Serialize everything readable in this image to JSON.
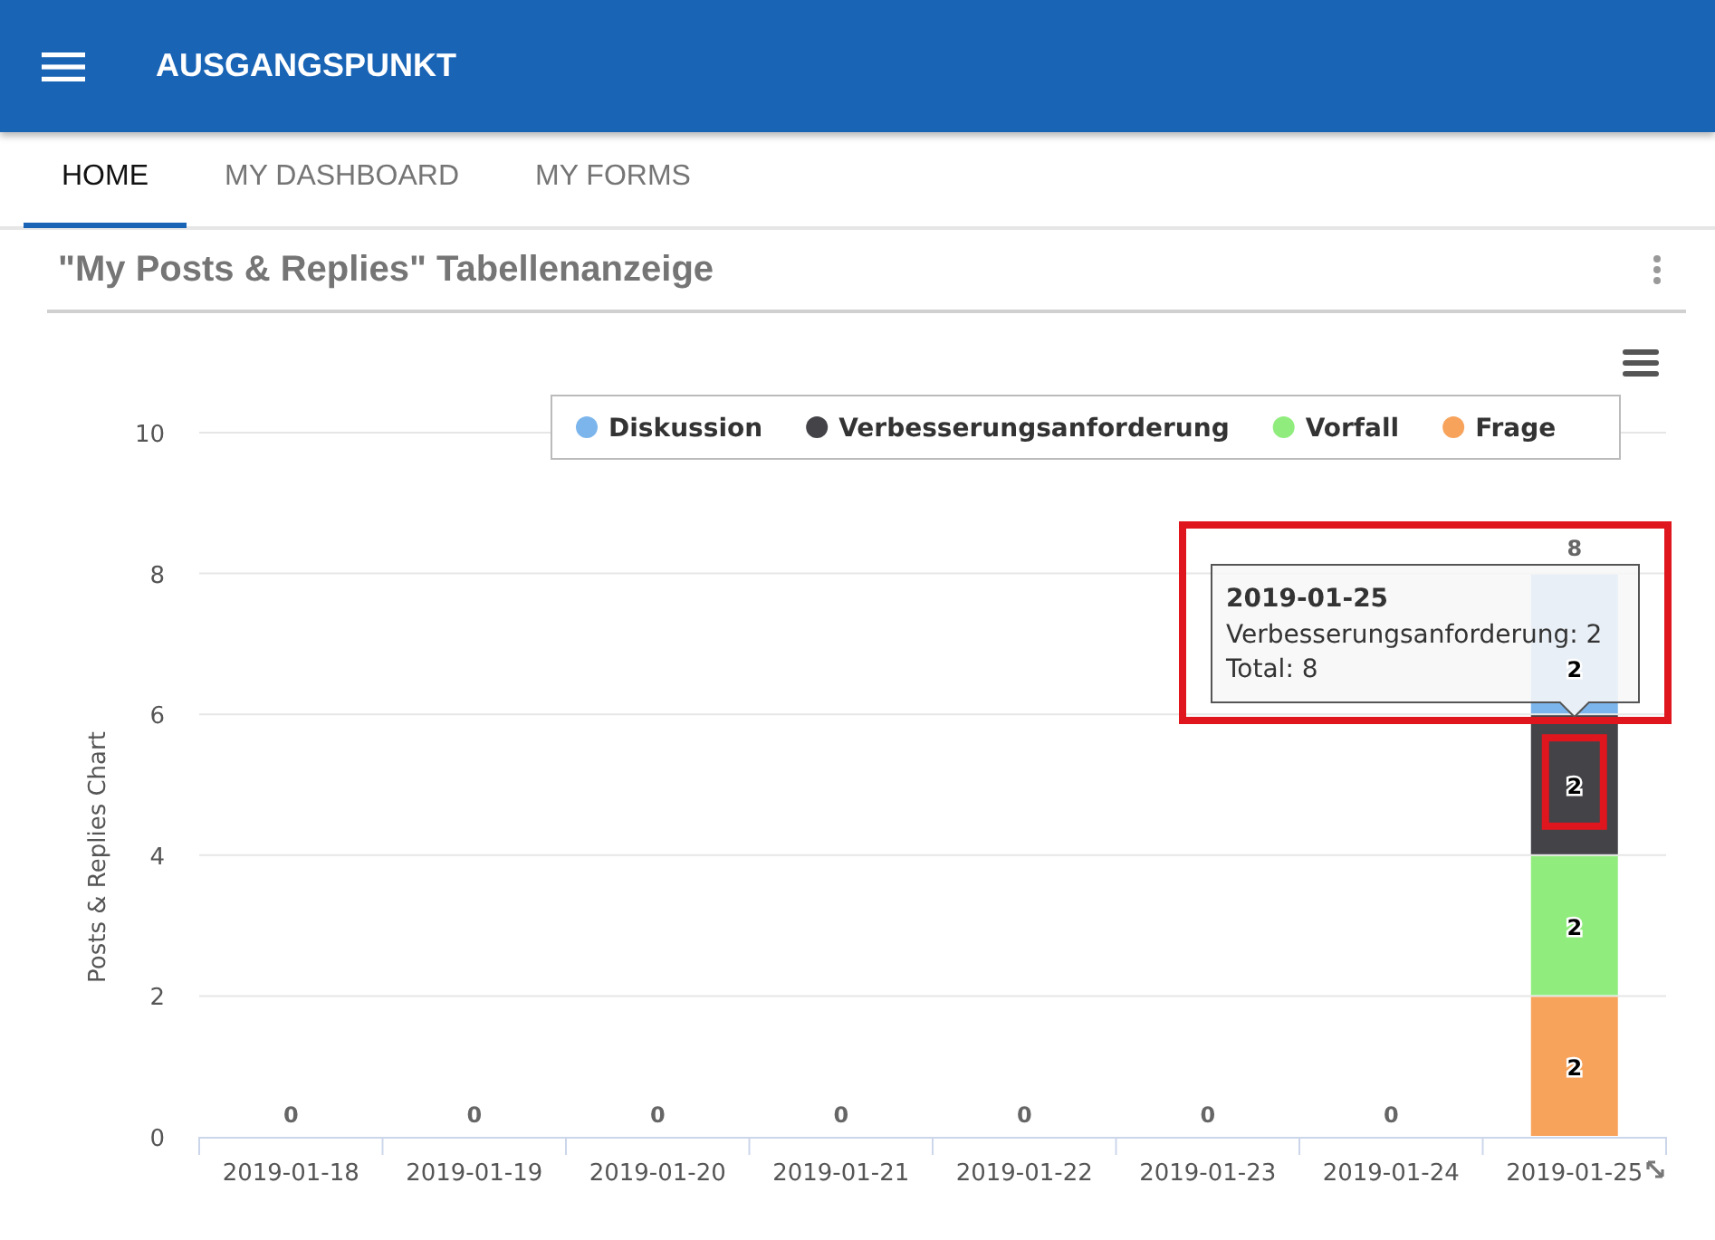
{
  "app_bar": {
    "title": "AUSGANGSPUNKT"
  },
  "tabs": [
    {
      "label": "HOME",
      "selected": true
    },
    {
      "label": "MY DASHBOARD",
      "selected": false
    },
    {
      "label": "MY FORMS",
      "selected": false
    }
  ],
  "card": {
    "title": "\"My Posts & Replies\" Tabellenanzeige",
    "chart_data": {
      "type": "bar",
      "orientation": "vertical",
      "stacked": true,
      "ylabel": "Posts & Replies Chart",
      "grid": true,
      "legend": true,
      "categories": [
        "2019-01-18",
        "2019-01-19",
        "2019-01-20",
        "2019-01-21",
        "2019-01-22",
        "2019-01-23",
        "2019-01-24",
        "2019-01-25"
      ],
      "series": [
        {
          "name": "Diskussion",
          "color": "#7cb5ec",
          "values": [
            0,
            0,
            0,
            0,
            0,
            0,
            0,
            2
          ],
          "value_labels": [
            null,
            null,
            null,
            null,
            null,
            null,
            null,
            "2"
          ]
        },
        {
          "name": "Verbesserungsanforderung",
          "color": "#434348",
          "values": [
            0,
            0,
            0,
            0,
            0,
            0,
            0,
            2
          ],
          "value_labels": [
            null,
            null,
            null,
            null,
            null,
            null,
            null,
            "2"
          ]
        },
        {
          "name": "Vorfall",
          "color": "#90ed7d",
          "values": [
            0,
            0,
            0,
            0,
            0,
            0,
            0,
            2
          ],
          "value_labels": [
            null,
            null,
            null,
            null,
            null,
            null,
            null,
            "2"
          ]
        },
        {
          "name": "Frage",
          "color": "#f7a35c",
          "values": [
            0,
            0,
            0,
            0,
            0,
            0,
            0,
            2
          ],
          "value_labels": [
            "0",
            "0",
            "0",
            "0",
            "0",
            "0",
            "0",
            "2"
          ]
        }
      ],
      "ylim": [
        0,
        10
      ],
      "yticks": [
        0,
        2,
        4,
        6,
        8,
        10
      ],
      "annotations": [
        {
          "text": "8",
          "x": "2019-01-25",
          "y": 8
        }
      ]
    },
    "tooltip": {
      "title": "2019-01-25",
      "lines": [
        "Verbesserungsanforderung: 2",
        "Total: 8"
      ]
    },
    "highlights": {
      "tooltip": true,
      "segment": true
    }
  }
}
